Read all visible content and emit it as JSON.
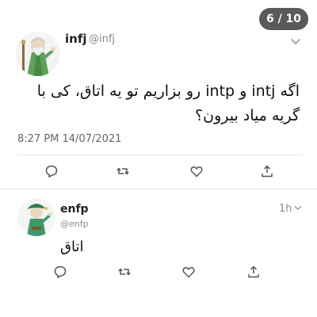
{
  "gallery": {
    "counter": "6 / 10"
  },
  "tweet": {
    "display_name": "infj",
    "handle": "@infj",
    "text_line1": "اگه intj و intp رو بزاریم تو یه اتاق، کی با",
    "text_line2": "گریه میاد بیرون؟",
    "timestamp": "8:27 PM 14/07/2021",
    "actions": [
      "reply-icon",
      "retweet-icon",
      "like-icon",
      "share-icon"
    ]
  },
  "reply": {
    "display_name": "enfp",
    "handle": "@enfp",
    "time_ago": "1h",
    "text": "اتاق",
    "actions": [
      "reply-icon",
      "retweet-icon",
      "like-icon",
      "share-icon"
    ]
  },
  "colors": {
    "avatar_infj": "#5fa35a",
    "avatar_enfp": "#3f9a6a",
    "counter_bg": "#5a5a5a"
  }
}
